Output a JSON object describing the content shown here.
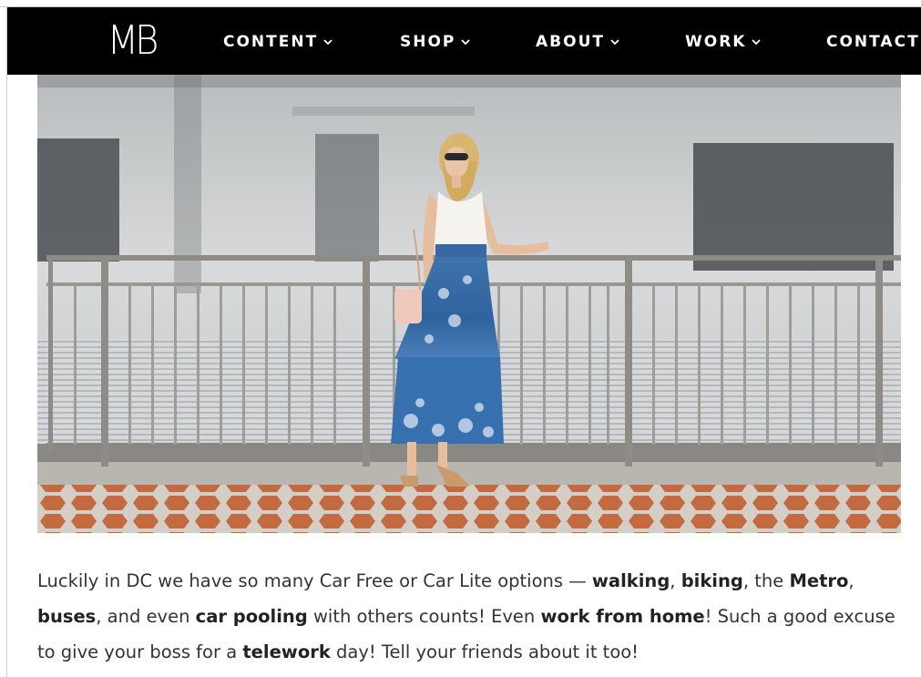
{
  "logo": {
    "text": "MB"
  },
  "nav": {
    "items": [
      {
        "label": "CONTENT"
      },
      {
        "label": "SHOP"
      },
      {
        "label": "ABOUT"
      },
      {
        "label": "WORK"
      },
      {
        "label": "CONTACT"
      }
    ]
  },
  "hero": {
    "description": "photo"
  },
  "article": {
    "p1": "Luckily in DC we have so many Car Free or Car Lite options — ",
    "b1": "walking",
    "p2": ", ",
    "b2": "biking",
    "p3": ", the ",
    "b3": "Metro",
    "p4": ", ",
    "b4": "buses",
    "p5": ", and even ",
    "b5": "car pooling",
    "p6": " with others counts! Even ",
    "b6": "work from home",
    "p7": "! Such a good excuse to give your boss for a ",
    "b7": "telework",
    "p8": " day! Tell your friends about it too!"
  },
  "colors": {
    "nav_bg": "#000000",
    "nav_text": "#ffffff",
    "body_text": "#333333",
    "tile": "#c0643c"
  }
}
